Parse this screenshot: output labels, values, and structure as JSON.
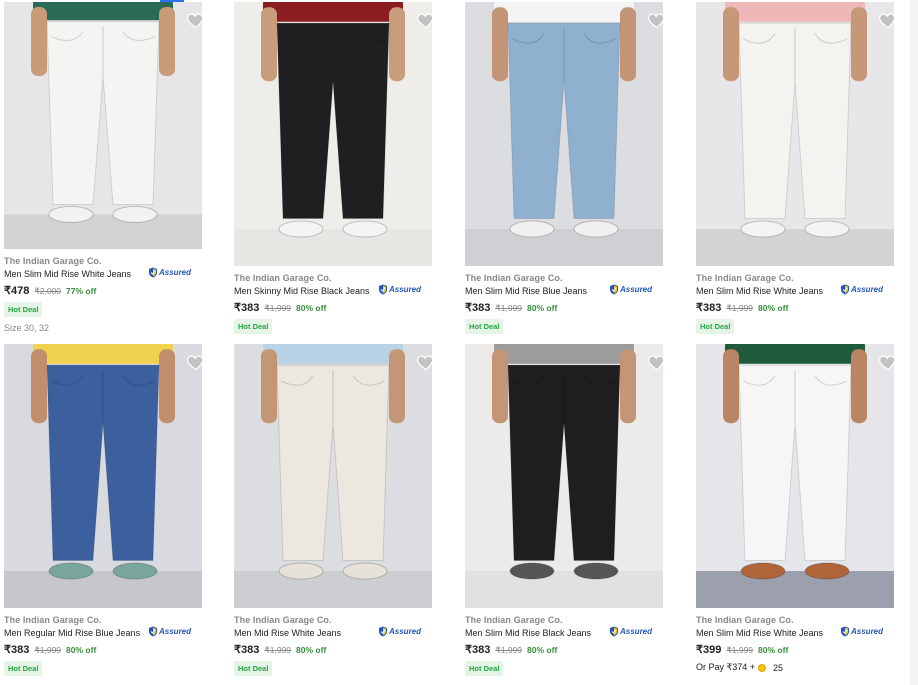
{
  "colors": {
    "accent": "#2874f0",
    "offer_green": "#388e3c",
    "hot_deal_bg": "#e4f4e6",
    "assured_blue": "#2455b9"
  },
  "assured_label": "Assured",
  "hot_deal_label": "Hot Deal",
  "products": [
    {
      "brand": "The Indian Garage Co.",
      "title": "Men Slim Mid Rise White Jeans",
      "price": "₹478",
      "mrp": "₹2,000",
      "discount": "77% off",
      "assured": true,
      "hot_deal": true,
      "size_text": "Size 30, 32",
      "image": {
        "bg": "#e6e6e8",
        "floor": "#d2d2d4",
        "top": "#2b6b55",
        "pants": "#f4f4f2",
        "shoes": "#f2f2f2",
        "skin": "#c79a78"
      }
    },
    {
      "brand": "The Indian Garage Co.",
      "title": "Men Skinny Mid Rise Black Jeans",
      "price": "₹383",
      "mrp": "₹1,999",
      "discount": "80% off",
      "assured": true,
      "hot_deal": true,
      "image": {
        "bg": "#efedea",
        "floor": "#e8e6e2",
        "top": "#8b1c20",
        "pants": "#1f1f22",
        "shoes": "#f4f4f4",
        "skin": "#c99c7c"
      }
    },
    {
      "brand": "The Indian Garage Co.",
      "title": "Men Slim Mid Rise Blue Jeans",
      "price": "₹383",
      "mrp": "₹1,999",
      "discount": "80% off",
      "assured": true,
      "hot_deal": true,
      "image": {
        "bg": "#dcdde0",
        "floor": "#cfd0d3",
        "top": "#f4f4f4",
        "pants": "#8fb1cf",
        "shoes": "#f0f0f0",
        "skin": "#c49476"
      }
    },
    {
      "brand": "The Indian Garage Co.",
      "title": "Men Slim Mid Rise White Jeans",
      "price": "₹383",
      "mrp": "₹1,999",
      "discount": "80% off",
      "assured": true,
      "hot_deal": true,
      "image": {
        "bg": "#e7e7e9",
        "floor": "#d3d3d6",
        "top": "#f0b7b9",
        "pants": "#f3f3ef",
        "shoes": "#f3f3f3",
        "skin": "#c69878"
      }
    },
    {
      "brand": "The Indian Garage Co.",
      "title": "Men Regular Mid Rise Blue Jeans",
      "price": "₹383",
      "mrp": "₹1,999",
      "discount": "80% off",
      "assured": true,
      "hot_deal": true,
      "image": {
        "bg": "#d8dadf",
        "floor": "#c5c7cb",
        "top": "#f1d24e",
        "pants": "#3c5f9e",
        "shoes": "#7aa59a",
        "skin": "#c18f6e"
      }
    },
    {
      "brand": "The Indian Garage Co.",
      "title": "Men Mid Rise White Jeans",
      "price": "₹383",
      "mrp": "₹1,999",
      "discount": "80% off",
      "assured": true,
      "hot_deal": true,
      "image": {
        "bg": "#dcdde0",
        "floor": "#cdced1",
        "top": "#b9d3e6",
        "pants": "#ece8df",
        "shoes": "#e6e2da",
        "skin": "#c59676"
      }
    },
    {
      "brand": "The Indian Garage Co.",
      "title": "Men Slim Mid Rise Black Jeans",
      "price": "₹383",
      "mrp": "₹1,999",
      "discount": "80% off",
      "assured": true,
      "hot_deal": true,
      "image": {
        "bg": "#ecebea",
        "floor": "#e2e1df",
        "top": "#9c9c9c",
        "pants": "#1e1e20",
        "shoes": "#555555",
        "skin": "#c49577"
      }
    },
    {
      "brand": "The Indian Garage Co.",
      "title": "Men Slim Mid Rise White Jeans",
      "price": "₹399",
      "mrp": "₹1,999",
      "discount": "80% off",
      "assured": true,
      "hot_deal": false,
      "or_pay": {
        "text": "Or Pay ₹374 +",
        "coins": "25"
      },
      "image": {
        "bg": "#e6e6ea",
        "floor": "#9c9fae",
        "top": "#1f5a3c",
        "pants": "#f6f6f6",
        "shoes": "#b0643a",
        "skin": "#b98562"
      }
    }
  ]
}
